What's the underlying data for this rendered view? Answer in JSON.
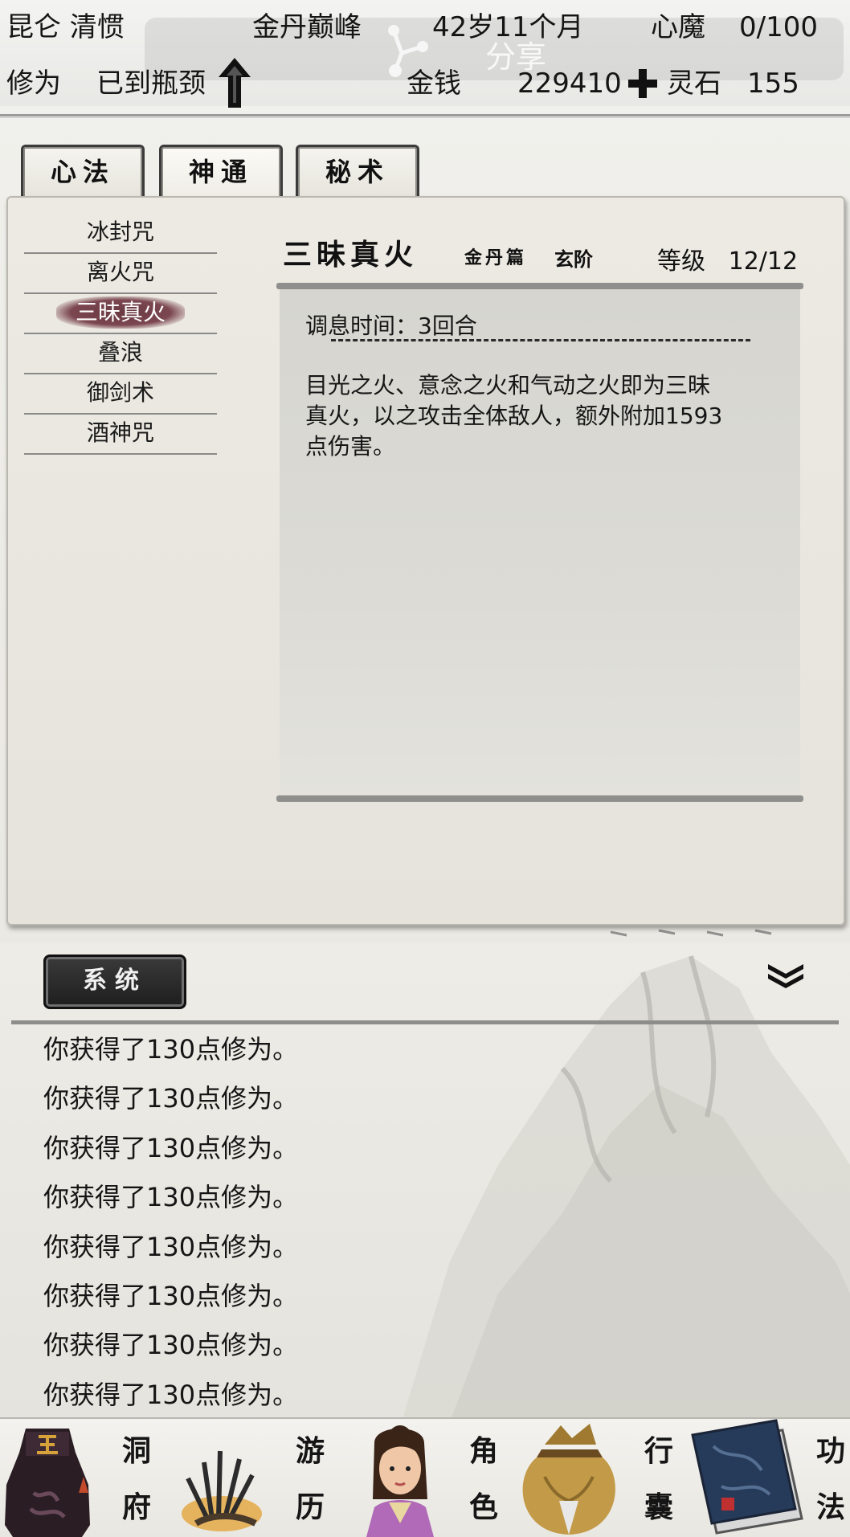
{
  "header": {
    "sect_name": "昆仑 清惯",
    "realm": "金丹巅峰",
    "age": "42岁11个月",
    "heart_demon_label": "心魔",
    "heart_demon_value": "0/100",
    "cultivation_label": "修为",
    "cultivation_value": "已到瓶颈",
    "money_label": "金钱",
    "money_value": "229410",
    "spirit_stone_label": "灵石",
    "spirit_stone_value": "155",
    "share_label": "分享"
  },
  "tabs": [
    {
      "label": "心法"
    },
    {
      "label": "神通"
    },
    {
      "label": "秘术"
    }
  ],
  "skills": [
    {
      "label": "冰封咒"
    },
    {
      "label": "离火咒"
    },
    {
      "label": "三昧真火"
    },
    {
      "label": "叠浪"
    },
    {
      "label": "御剑术"
    },
    {
      "label": "酒神咒"
    }
  ],
  "detail": {
    "name": "三昧真火",
    "chapter": "金丹篇",
    "tier": "玄阶",
    "level_label": "等级",
    "level_value": "12/12",
    "cooldown": "调息时间：3回合",
    "desc_line1": "目光之火、意念之火和气动之火即为三昧",
    "desc_line2": "真火，以之攻击全体敌人，额外附加1593",
    "desc_line3": "点伤害。"
  },
  "log": {
    "system_label": "系统",
    "lines": [
      "你获得了130点修为。",
      "你获得了130点修为。",
      "你获得了130点修为。",
      "你获得了130点修为。",
      "你获得了130点修为。",
      "你获得了130点修为。",
      "你获得了130点修为。",
      "你获得了130点修为。"
    ]
  },
  "nav": {
    "dongfu_1": "洞",
    "dongfu_2": "府",
    "youli_1": "游",
    "youli_2": "历",
    "juese_1": "角",
    "juese_2": "色",
    "xingnang_1": "行",
    "xingnang_2": "囊",
    "gongfa_1": "功",
    "gongfa_2": "法"
  },
  "colors": {
    "selected_skill": "#7b4650",
    "dark_button": "#2a2a2a",
    "paper": "#eceae3"
  }
}
